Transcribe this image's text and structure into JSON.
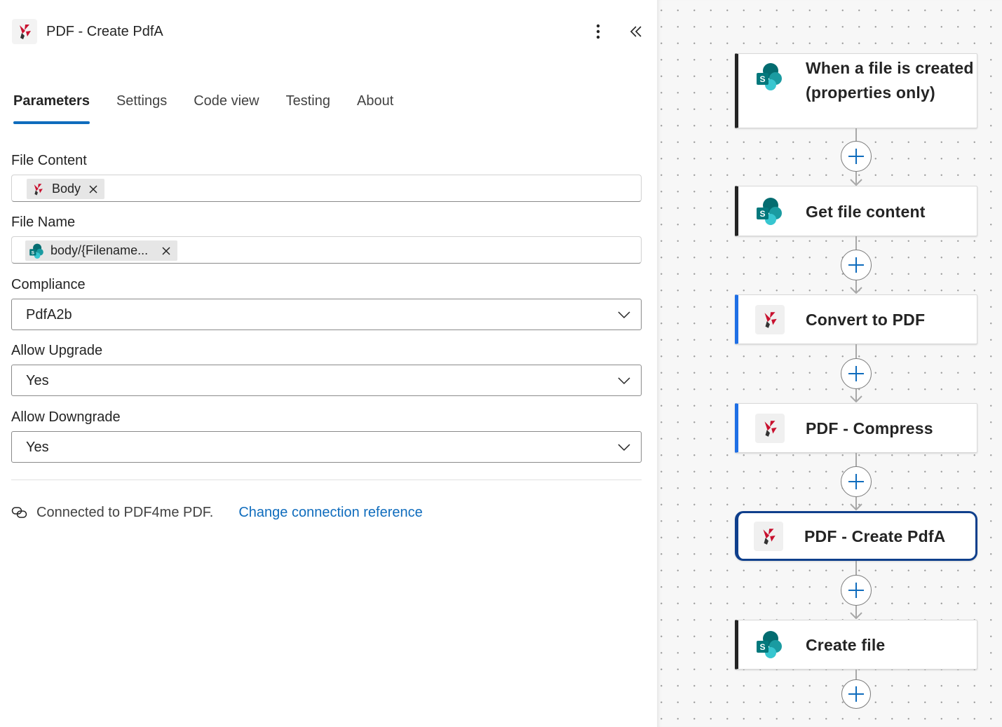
{
  "header": {
    "title": "PDF - Create PdfA"
  },
  "tabs": [
    {
      "label": "Parameters"
    },
    {
      "label": "Settings"
    },
    {
      "label": "Code view"
    },
    {
      "label": "Testing"
    },
    {
      "label": "About"
    }
  ],
  "fields": {
    "file_content": {
      "label": "File Content",
      "token": "Body"
    },
    "file_name": {
      "label": "File Name",
      "token": "body/{Filename..."
    },
    "compliance": {
      "label": "Compliance",
      "value": "PdfA2b"
    },
    "allow_upgrade": {
      "label": "Allow Upgrade",
      "value": "Yes"
    },
    "allow_downgrade": {
      "label": "Allow Downgrade",
      "value": "Yes"
    }
  },
  "connection": {
    "text": "Connected to PDF4me PDF.",
    "link": "Change connection reference"
  },
  "flow": {
    "nodes": [
      {
        "title": "When a file is created (properties only)",
        "icon": "sharepoint-icon"
      },
      {
        "title": "Get file content",
        "icon": "sharepoint-icon"
      },
      {
        "title": "Convert to PDF",
        "icon": "pdf4me-icon"
      },
      {
        "title": "PDF - Compress",
        "icon": "pdf4me-icon"
      },
      {
        "title": "PDF - Create PdfA",
        "icon": "pdf4me-icon",
        "selected": true
      },
      {
        "title": "Create file",
        "icon": "sharepoint-icon"
      }
    ]
  },
  "colors": {
    "accent": "#0f6cbd",
    "selected_border": "#0f3f8c",
    "action_stripe": "#1f6fe5",
    "sharepoint_stripe": "#242424"
  }
}
